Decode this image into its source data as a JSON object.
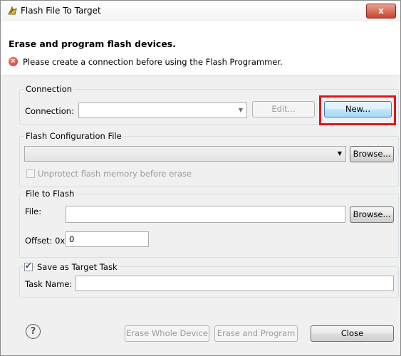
{
  "window": {
    "title": "Flash File To Target",
    "close_glyph": "x"
  },
  "header": {
    "title": "Erase and program flash devices.",
    "error_message": "Please create a connection before using the Flash Programmer."
  },
  "connection": {
    "group_label": "Connection",
    "field_label": "Connection:",
    "value": "",
    "edit_label": "Edit...",
    "new_label": "New..."
  },
  "flash_config": {
    "group_label": "Flash Configuration File",
    "value": "",
    "browse_label": "Browse...",
    "unprotect_label": "Unprotect flash memory before erase",
    "unprotect_checked": false
  },
  "file_to_flash": {
    "group_label": "File to Flash",
    "file_label": "File:",
    "file_value": "",
    "browse_label": "Browse...",
    "offset_label": "Offset: 0x",
    "offset_value": "0"
  },
  "target_task": {
    "checkbox_label": "Save as Target Task",
    "checked": true,
    "task_name_label": "Task Name:",
    "task_name_value": ""
  },
  "footer": {
    "help_glyph": "?",
    "erase_whole_label": "Erase Whole Device",
    "erase_program_label": "Erase and Program",
    "close_label": "Close"
  },
  "icons": {
    "title": "flash-programmer-icon",
    "error": "error-icon",
    "help": "help-icon",
    "dropdown": "chevron-down-icon"
  },
  "colors": {
    "highlight": "#e0141b",
    "error": "#d12e1f",
    "close_button": "#c7432c"
  }
}
